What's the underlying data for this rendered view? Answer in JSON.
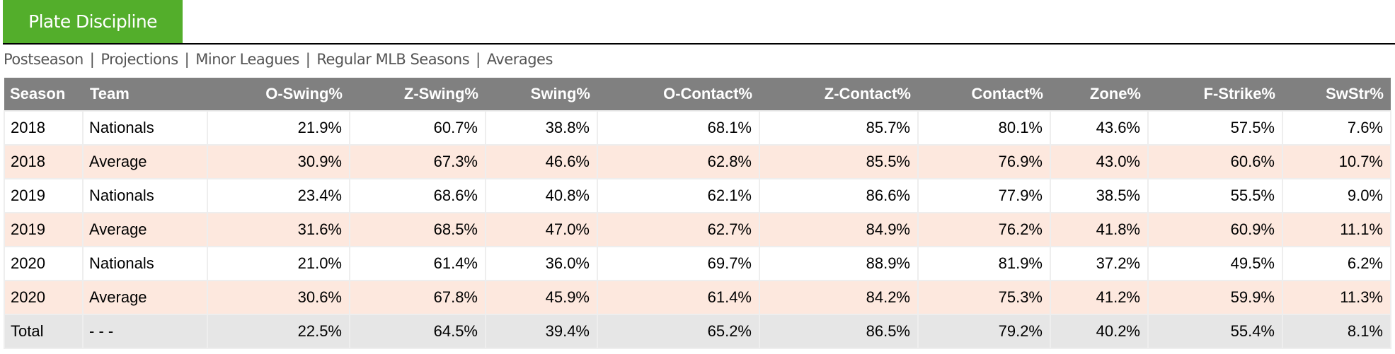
{
  "section": {
    "title": "Plate Discipline",
    "header_color": "#53ae2b"
  },
  "nav": {
    "links": [
      "Postseason",
      "Projections",
      "Minor Leagues",
      "Regular MLB Seasons",
      "Averages"
    ],
    "separator": "|"
  },
  "table": {
    "columns": [
      "Season",
      "Team",
      "O-Swing%",
      "Z-Swing%",
      "Swing%",
      "O-Contact%",
      "Z-Contact%",
      "Contact%",
      "Zone%",
      "F-Strike%",
      "SwStr%"
    ],
    "rows": [
      {
        "type": "team",
        "cells": [
          "2018",
          "Nationals",
          "21.9%",
          "60.7%",
          "38.8%",
          "68.1%",
          "85.7%",
          "80.1%",
          "43.6%",
          "57.5%",
          "7.6%"
        ]
      },
      {
        "type": "avg",
        "cells": [
          "2018",
          "Average",
          "30.9%",
          "67.3%",
          "46.6%",
          "62.8%",
          "85.5%",
          "76.9%",
          "43.0%",
          "60.6%",
          "10.7%"
        ]
      },
      {
        "type": "team",
        "cells": [
          "2019",
          "Nationals",
          "23.4%",
          "68.6%",
          "40.8%",
          "62.1%",
          "86.6%",
          "77.9%",
          "38.5%",
          "55.5%",
          "9.0%"
        ]
      },
      {
        "type": "avg",
        "cells": [
          "2019",
          "Average",
          "31.6%",
          "68.5%",
          "47.0%",
          "62.7%",
          "84.9%",
          "76.2%",
          "41.8%",
          "60.9%",
          "11.1%"
        ]
      },
      {
        "type": "team",
        "cells": [
          "2020",
          "Nationals",
          "21.0%",
          "61.4%",
          "36.0%",
          "69.7%",
          "88.9%",
          "81.9%",
          "37.2%",
          "49.5%",
          "6.2%"
        ]
      },
      {
        "type": "avg",
        "cells": [
          "2020",
          "Average",
          "30.6%",
          "67.8%",
          "45.9%",
          "61.4%",
          "84.2%",
          "75.3%",
          "41.2%",
          "59.9%",
          "11.3%"
        ]
      },
      {
        "type": "total",
        "cells": [
          "Total",
          "- - -",
          "22.5%",
          "64.5%",
          "39.4%",
          "65.2%",
          "86.5%",
          "79.2%",
          "40.2%",
          "55.4%",
          "8.1%"
        ]
      }
    ]
  }
}
